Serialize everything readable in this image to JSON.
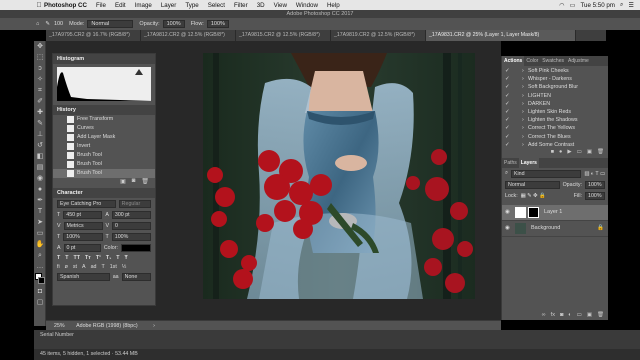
{
  "menubar": {
    "apple": "",
    "items": [
      "Photoshop CC",
      "File",
      "Edit",
      "Image",
      "Layer",
      "Type",
      "Select",
      "Filter",
      "3D",
      "View",
      "Window",
      "Help"
    ],
    "time": "Tue 5:50 pm"
  },
  "window_title": "Adobe Photoshop CC 2017",
  "options": {
    "brush_size": "100",
    "mode_label": "Mode:",
    "mode_value": "Normal",
    "opacity_label": "Opacity:",
    "opacity_value": "100%",
    "flow_label": "Flow:",
    "flow_value": "100%"
  },
  "tabs": [
    {
      "label": "_17A9795.CR2 @ 16.7% (RGB/8*)"
    },
    {
      "label": "_17A9812.CR2 @ 12.5% (RGB/8*)"
    },
    {
      "label": "_17A9815.CR2 @ 12.5% (RGB/8*)"
    },
    {
      "label": "_17A9819.CR2 @ 12.5% (RGB/8*)"
    },
    {
      "label": "_17A9831.CR2 @ 25% (Layer 1, Layer Mask/8)",
      "active": true
    }
  ],
  "histogram": {
    "title": "Histogram"
  },
  "history": {
    "title": "History",
    "items": [
      "Free Transform",
      "Curves",
      "Add Layer Mask",
      "Invert",
      "Brush Tool",
      "Brush Tool",
      "Brush Tool"
    ]
  },
  "character": {
    "title": "Character",
    "font": "Eye Catching Pro",
    "style": "Regular",
    "size": "450 pt",
    "leading": "300 pt",
    "kerning": "Metrics",
    "tracking": "0",
    "vscale": "100%",
    "hscale": "100%",
    "baseline": "0 pt",
    "color_label": "Color:",
    "language": "Spanish",
    "aa": "None"
  },
  "actions": {
    "tabs": [
      "Actions",
      "Color",
      "Swatches",
      "Adjustme"
    ],
    "items": [
      "Soft Pink Cheeks",
      "Whisper - Darkens",
      "Soft Background Blur",
      "LIGHTEN",
      "DARKEN",
      "Lighten Skin Reds",
      "Lighten the Shadows",
      "Correct The Yellows",
      "Correct The Blues",
      "Add Some Contrast"
    ]
  },
  "layers": {
    "tabs": [
      "Paths",
      "Layers"
    ],
    "kind": "Kind",
    "blend": "Normal",
    "opacity_label": "Opacity:",
    "opacity": "100%",
    "lock_label": "Lock:",
    "fill_label": "Fill:",
    "fill": "100%",
    "items": [
      {
        "name": "Layer 1",
        "selected": true
      },
      {
        "name": "Background"
      }
    ]
  },
  "status": {
    "zoom": "25%",
    "profile": "Adobe RGB (1998) (8bpc)"
  },
  "finder": {
    "row": "Serial Number",
    "bottom": "45 items, 5 hidden, 1 selected · 53.44 MB"
  },
  "colors": {
    "panel": "#535353",
    "dark": "#282828",
    "dress": "#4f7a96"
  }
}
